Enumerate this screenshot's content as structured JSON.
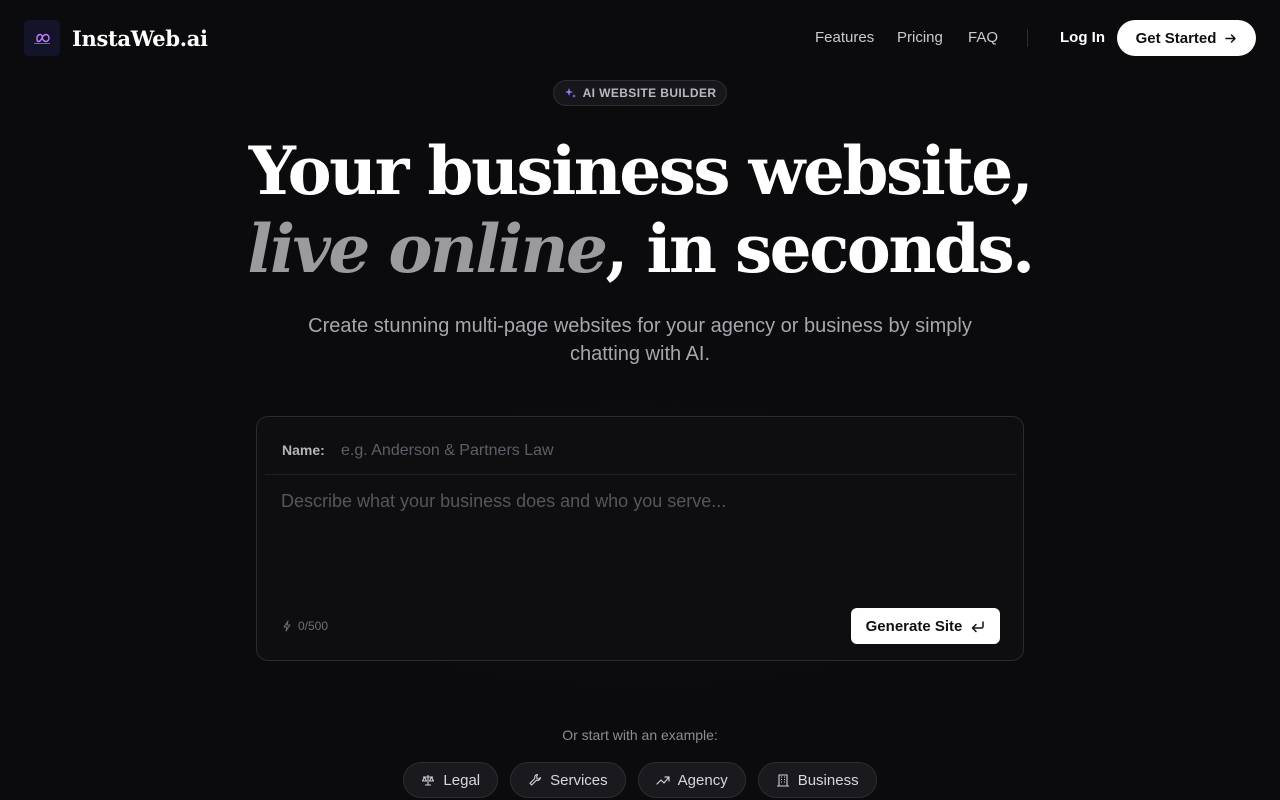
{
  "header": {
    "brand": "InstaWeb.ai",
    "nav": [
      {
        "label": "Features"
      },
      {
        "label": "Pricing"
      },
      {
        "label": "FAQ"
      }
    ],
    "login_label": "Log In",
    "cta_label": "Get Started"
  },
  "badge": {
    "label": "AI WEBSITE BUILDER",
    "icon": "sparkle-icon"
  },
  "hero": {
    "line1": "Your business website,",
    "line2_italic": "live online",
    "line2_rest": ", in seconds.",
    "subtitle": "Create stunning multi-page websites for your agency or business by simply chatting with AI."
  },
  "form": {
    "name_label": "Name:",
    "name_placeholder": "e.g. Anderson & Partners Law",
    "description_placeholder": "Describe what your business does and who you serve...",
    "counter": "0/500",
    "generate_label": "Generate Site"
  },
  "examples": {
    "label": "Or start with an example:",
    "items": [
      {
        "label": "Legal",
        "icon": "scale-icon"
      },
      {
        "label": "Services",
        "icon": "wrench-icon"
      },
      {
        "label": "Agency",
        "icon": "trend-up-icon"
      },
      {
        "label": "Business",
        "icon": "building-icon"
      }
    ]
  },
  "colors": {
    "background": "#0b0b0d",
    "accent": "#7c5cff",
    "button": "#ffffff"
  }
}
